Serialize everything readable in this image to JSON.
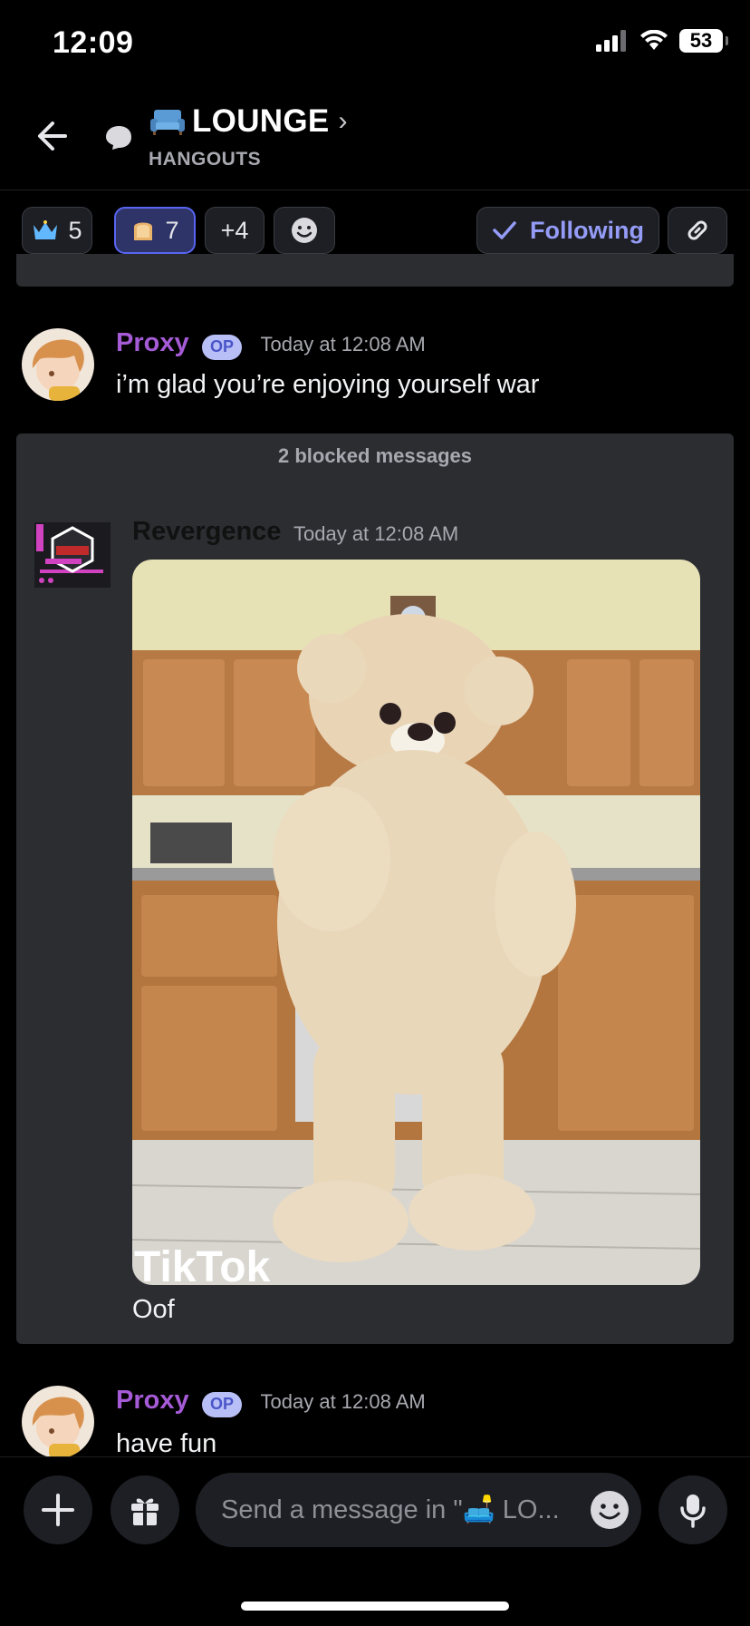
{
  "status_bar": {
    "time": "12:09",
    "battery": "53"
  },
  "header": {
    "title": "LOUNGE",
    "title_chevron": "›",
    "subtitle": "HANGOUTS",
    "title_emoji_icon": "couch-icon"
  },
  "chips": [
    {
      "icon": "crown-icon",
      "count": "5",
      "selected": false
    },
    {
      "icon": "toast-icon",
      "count": "7",
      "selected": true
    },
    {
      "label": "+4"
    },
    {
      "icon": "emoji-add-icon"
    }
  ],
  "following_label": "Following",
  "messages": [
    {
      "author": "Proxy",
      "badge": "OP",
      "time": "Today at 12:08 AM",
      "text": "i’m glad you’re enjoying yourself war"
    },
    {
      "author": "Revergence",
      "time": "Today at 12:08 AM",
      "media_watermark": "TikTok",
      "text": "Oof"
    },
    {
      "author": "Proxy",
      "badge": "OP",
      "time": "Today at 12:08 AM",
      "text": "have fun"
    }
  ],
  "blocked_label": "2 blocked messages",
  "composer": {
    "placeholder": "Send a message in \"🛋️ LO..."
  },
  "colors": {
    "accent": "#5865f2",
    "author_proxy": "#a55ad6",
    "background": "#000000",
    "block_bg": "#2b2d31"
  }
}
